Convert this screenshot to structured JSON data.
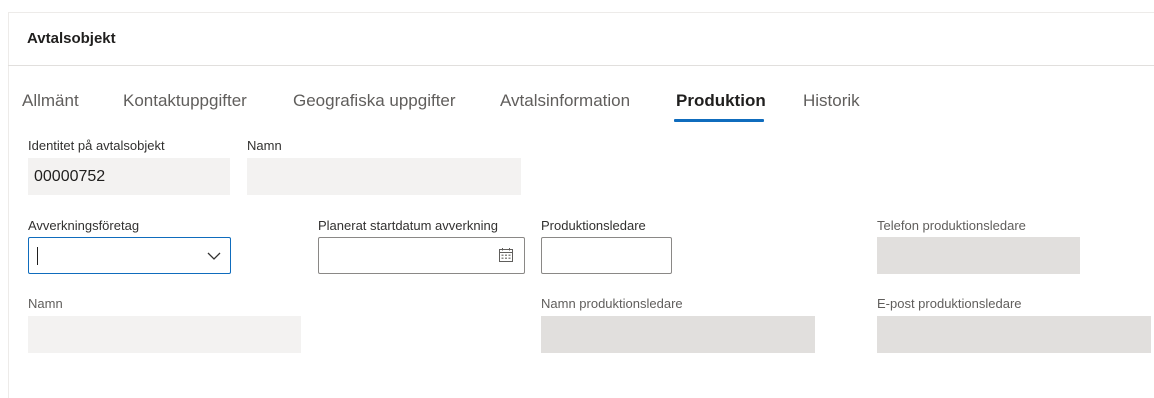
{
  "header": {
    "title": "Avtalsobjekt"
  },
  "tabs": [
    {
      "label": "Allmänt"
    },
    {
      "label": "Kontaktuppgifter"
    },
    {
      "label": "Geografiska uppgifter"
    },
    {
      "label": "Avtalsinformation"
    },
    {
      "label": "Produktion"
    },
    {
      "label": "Historik"
    }
  ],
  "active_tab": "Produktion",
  "fields": {
    "identity": {
      "label": "Identitet på avtalsobjekt",
      "value": "00000752"
    },
    "name_top": {
      "label": "Namn",
      "value": ""
    },
    "harvesting_company": {
      "label": "Avverkningsföretag",
      "value": ""
    },
    "planned_start": {
      "label": "Planerat startdatum avverkning",
      "value": ""
    },
    "production_manager": {
      "label": "Produktionsledare",
      "value": ""
    },
    "phone_manager": {
      "label": "Telefon produktionsledare",
      "value": ""
    },
    "name_bottom": {
      "label": "Namn",
      "value": ""
    },
    "manager_name": {
      "label": "Namn produktionsledare",
      "value": ""
    },
    "manager_email": {
      "label": "E-post produktionsledare",
      "value": ""
    }
  },
  "icons": {
    "dropdown": "chevron-down-icon",
    "date": "calendar-icon"
  },
  "colors": {
    "accent": "#0f6cbd",
    "readonly_bg": "#f3f2f1",
    "readonly_dark_bg": "#e1dfdd",
    "input_border": "#8a8886"
  }
}
